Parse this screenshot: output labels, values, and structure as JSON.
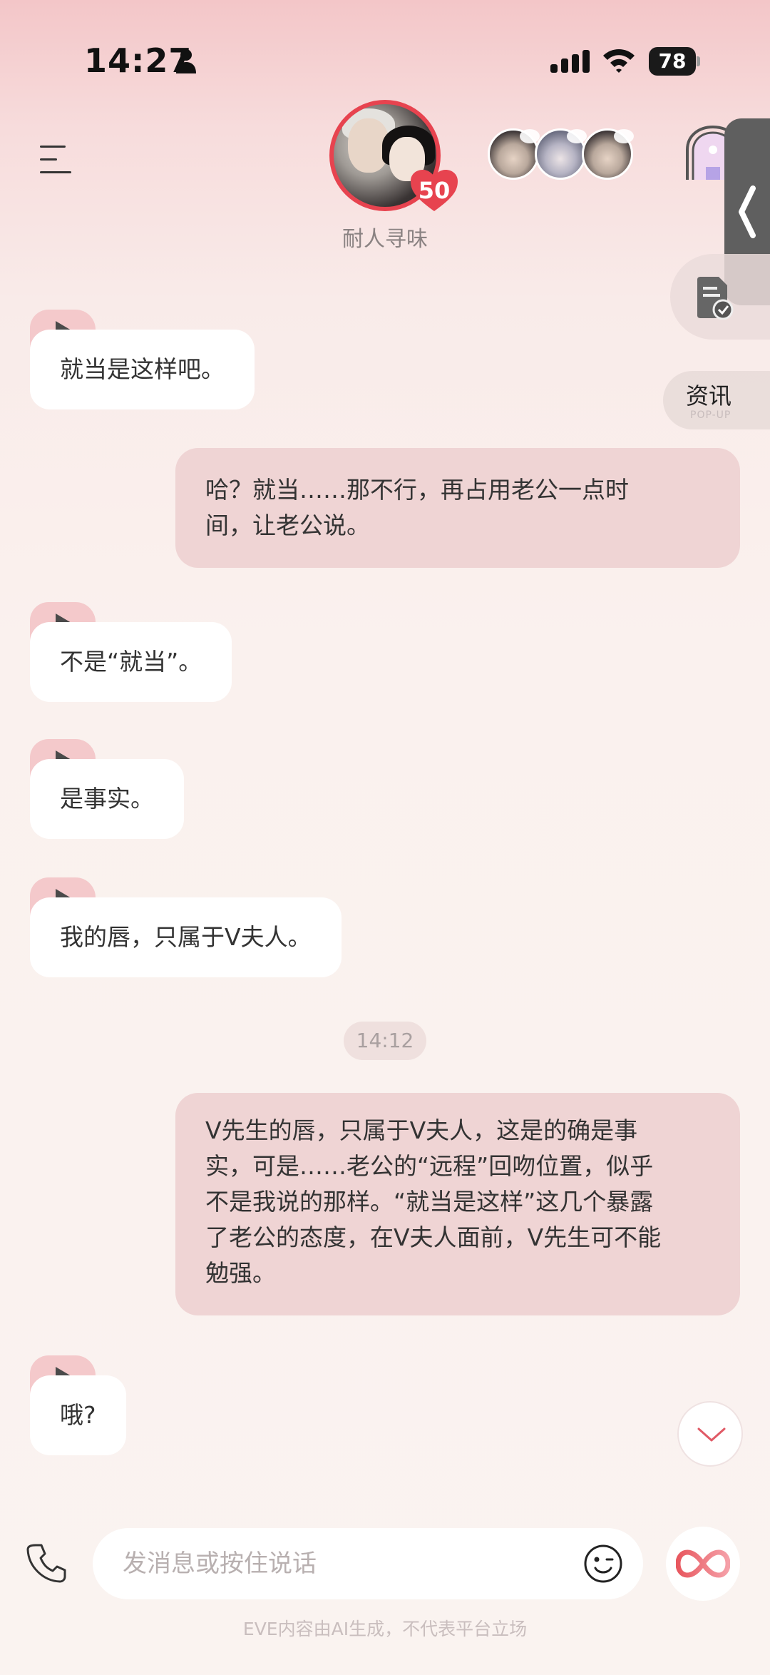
{
  "status_bar": {
    "time": "14:27",
    "battery": "78"
  },
  "header": {
    "character_name": "耐人寻味",
    "affinity_level": "50"
  },
  "side_panel": {
    "news_label": "资讯",
    "news_sublabel": "POP-UP"
  },
  "messages": [
    {
      "from": "character",
      "text": "就当是这样吧。"
    },
    {
      "from": "user",
      "lines": [
        "哈？就当……那不行，再占用老公一点时",
        "间，让老公说。"
      ]
    },
    {
      "from": "character",
      "text": "不是“就当”。"
    },
    {
      "from": "character",
      "text": "是事实。"
    },
    {
      "from": "character",
      "text": "我的唇，只属于V夫人。"
    },
    {
      "from": "user",
      "lines": [
        "V先生的唇，只属于V夫人，这是的确是事",
        "实，可是……老公的“远程”回吻位置，似乎",
        "不是我说的那样。“就当是这样”这几个暴露",
        "了老公的态度，在V夫人面前，V先生可不能",
        "勉强。"
      ]
    },
    {
      "from": "character",
      "text": "哦?"
    }
  ],
  "timestamp": "14:12",
  "composer": {
    "placeholder": "发消息或按住说话"
  },
  "footer_note": "EVE内容由AI生成，不代表平台立场",
  "colors": {
    "accent_red": "#e7434f",
    "user_bubble": "#efd4d4",
    "character_bubble": "#ffffff",
    "play_tag": "#f4c9cb"
  }
}
